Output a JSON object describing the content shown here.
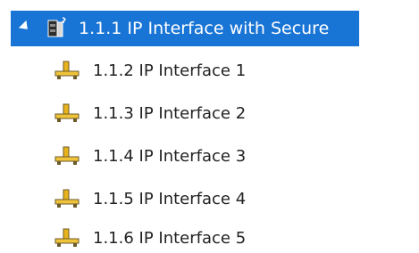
{
  "tree": {
    "parent": {
      "label": "1.1.1 IP Interface with Secure",
      "expanded": true,
      "selected": true,
      "icon": "secure-device-icon"
    },
    "children": [
      {
        "label": "1.1.2 IP Interface 1",
        "icon": "network-interface-icon"
      },
      {
        "label": "1.1.3 IP Interface 2",
        "icon": "network-interface-icon"
      },
      {
        "label": "1.1.4 IP Interface 3",
        "icon": "network-interface-icon"
      },
      {
        "label": "1.1.5 IP Interface 4",
        "icon": "network-interface-icon"
      },
      {
        "label": "1.1.6 IP Interface 5",
        "icon": "network-interface-icon"
      }
    ]
  },
  "colors": {
    "selection_background": "#1874d5",
    "selection_text": "#ffffff",
    "text": "#222222",
    "icon_yellow": "#e7b21c",
    "icon_dark": "#6b5a2a"
  }
}
